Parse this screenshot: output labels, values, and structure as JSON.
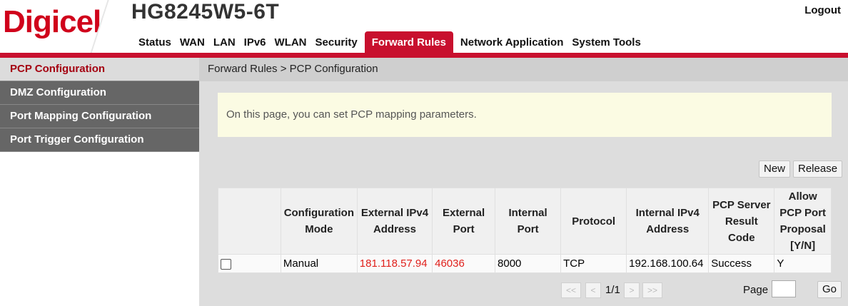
{
  "header": {
    "logo": "Digicel",
    "model": "HG8245W5-6T",
    "logout": "Logout"
  },
  "nav": {
    "items": [
      "Status",
      "WAN",
      "LAN",
      "IPv6",
      "WLAN",
      "Security",
      "Forward Rules",
      "Network Application",
      "System Tools"
    ],
    "active": "Forward Rules"
  },
  "sidebar": {
    "items": [
      {
        "label": "PCP Configuration",
        "active": true
      },
      {
        "label": "DMZ Configuration"
      },
      {
        "label": "Port Mapping Configuration"
      },
      {
        "label": "Port Trigger Configuration"
      }
    ]
  },
  "breadcrumb": "Forward Rules > PCP Configuration",
  "notice": "On this page, you can set PCP mapping parameters.",
  "buttons": {
    "new": "New",
    "release": "Release"
  },
  "table": {
    "headers": [
      "Configuration Mode",
      "External IPv4 Address",
      "External Port",
      "Internal Port",
      "Protocol",
      "Internal IPv4 Address",
      "PCP Server Result Code",
      "Allow PCP Port Proposal [Y/N]"
    ],
    "rows": [
      [
        "Manual",
        "181.118.57.94",
        "46036",
        "8000",
        "TCP",
        "192.168.100.64",
        "Success",
        "Y"
      ]
    ]
  },
  "pager": {
    "first": "<<",
    "prev": "<",
    "status": "1/1",
    "next": ">",
    "last": ">>",
    "page_label": "Page",
    "go": "Go"
  },
  "colors": {
    "brand_red": "#c8102e",
    "link_red": "#e0201b"
  }
}
